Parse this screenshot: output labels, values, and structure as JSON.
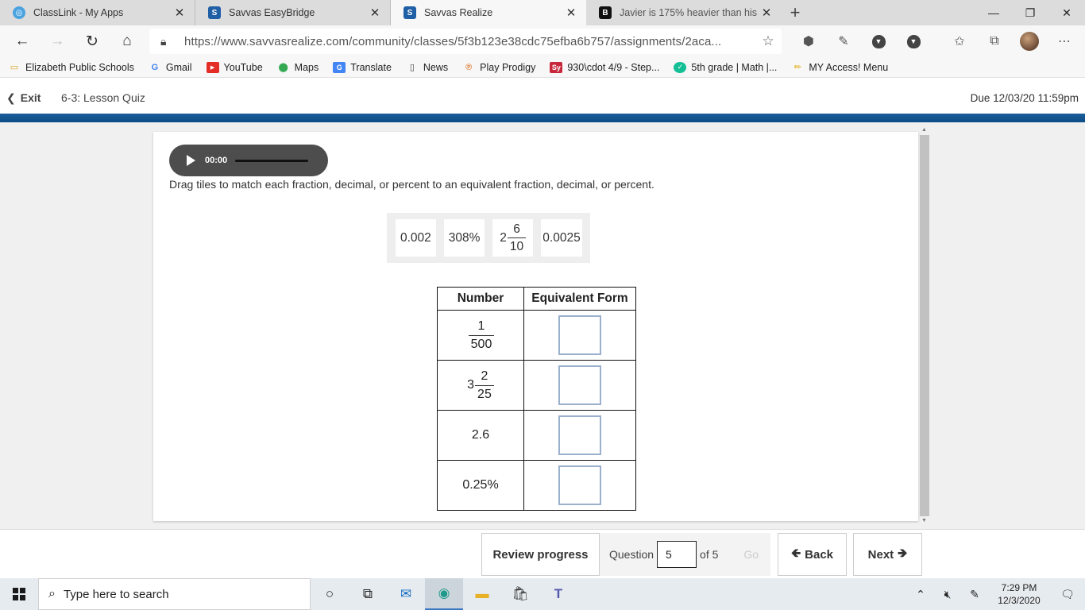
{
  "browser": {
    "tabs": [
      {
        "title": "ClassLink - My Apps",
        "active": false,
        "icon": "classlink-icon",
        "color": "#4aa3df"
      },
      {
        "title": "Savvas EasyBridge",
        "active": false,
        "icon": "savvas-icon",
        "color": "#1f5fa6"
      },
      {
        "title": "Savvas Realize",
        "active": true,
        "icon": "savvas-icon",
        "color": "#1f5fa6"
      },
      {
        "title": "Javier is 175% heavier than his b",
        "active": false,
        "icon": "brainly-icon",
        "color": "#111111"
      }
    ],
    "url": "https://www.savvasrealize.com/community/classes/5f3b123e38cdc75efba6b757/assignments/2aca...",
    "favorites": [
      {
        "label": "Elizabeth Public Schools",
        "icon": "folder-icon"
      },
      {
        "label": "Gmail",
        "icon": "google-icon"
      },
      {
        "label": "YouTube",
        "icon": "youtube-icon"
      },
      {
        "label": "Maps",
        "icon": "maps-pin-icon"
      },
      {
        "label": "Translate",
        "icon": "translate-icon"
      },
      {
        "label": "News",
        "icon": "page-icon"
      },
      {
        "label": "Play Prodigy",
        "icon": "prodigy-icon"
      },
      {
        "label": "930\\cdot 4/9 - Step...",
        "icon": "symbolab-icon"
      },
      {
        "label": "5th grade | Math |...",
        "icon": "khan-icon"
      },
      {
        "label": "MY Access! Menu",
        "icon": "pencil-icon"
      }
    ]
  },
  "app": {
    "exit_label": "Exit",
    "quiz_title": "6-3: Lesson Quiz",
    "due": "Due 12/03/20 11:59pm",
    "audio_time": "00:00",
    "instructions": "Drag tiles to match each fraction, decimal, or percent to an equivalent fraction, decimal, or percent.",
    "tiles": [
      {
        "text": "0.002"
      },
      {
        "text": "308%"
      },
      {
        "whole": "2",
        "num": "6",
        "den": "10"
      },
      {
        "text": "0.0025"
      }
    ],
    "table": {
      "headers": [
        "Number",
        "Equivalent Form"
      ],
      "rows": [
        {
          "num": "1",
          "den": "500"
        },
        {
          "whole": "3",
          "num": "2",
          "den": "25"
        },
        {
          "text": "2.6"
        },
        {
          "text": "0.25%"
        }
      ]
    }
  },
  "quiz_nav": {
    "review_label": "Review progress",
    "question_label": "Question",
    "question_value": "5",
    "of_label": "of 5",
    "go_label": "Go",
    "back_label": "Back",
    "next_label": "Next"
  },
  "taskbar": {
    "search_placeholder": "Type here to search",
    "time": "7:29 PM",
    "date": "12/3/2020"
  }
}
